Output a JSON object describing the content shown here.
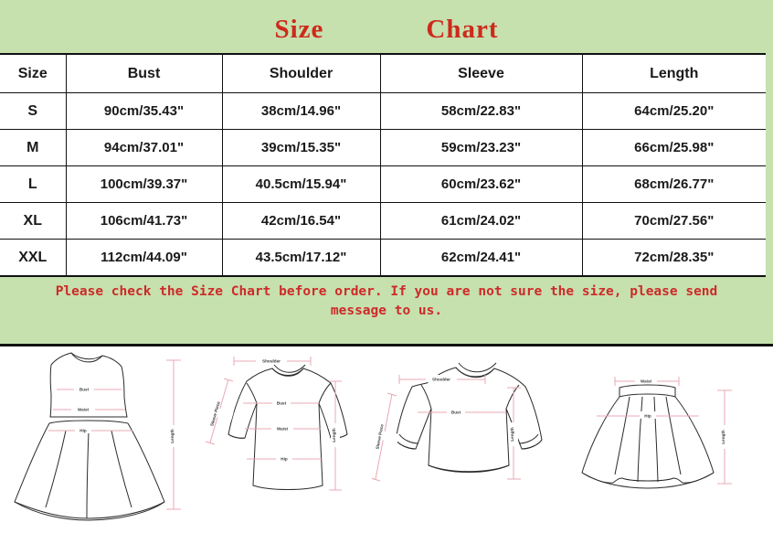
{
  "title": {
    "word1": "Size",
    "word2": "Chart"
  },
  "colors": {
    "panel_green": "#c6e0ae",
    "title_red": "#cd2a1c",
    "note_red": "#cd2a2a",
    "border_black": "#111111",
    "measure_pink": "#e8a8b4",
    "garment_outline": "#2b2b2b"
  },
  "table": {
    "headers": [
      "Size",
      "Bust",
      "Shoulder",
      "Sleeve",
      "Length"
    ],
    "rows": [
      {
        "size": "S",
        "bust": "90cm/35.43\"",
        "shoulder": "38cm/14.96\"",
        "sleeve": "58cm/22.83\"",
        "length": "64cm/25.20\""
      },
      {
        "size": "M",
        "bust": "94cm/37.01\"",
        "shoulder": "39cm/15.35\"",
        "sleeve": "59cm/23.23\"",
        "length": "66cm/25.98\""
      },
      {
        "size": "L",
        "bust": "100cm/39.37\"",
        "shoulder": "40.5cm/15.94\"",
        "sleeve": "60cm/23.62\"",
        "length": "68cm/26.77\""
      },
      {
        "size": "XL",
        "bust": "106cm/41.73\"",
        "shoulder": "42cm/16.54\"",
        "sleeve": "61cm/24.02\"",
        "length": "70cm/27.56\""
      },
      {
        "size": "XXL",
        "bust": "112cm/44.09\"",
        "shoulder": "43.5cm/17.12\"",
        "sleeve": "62cm/24.41\"",
        "length": "72cm/28.35\""
      }
    ]
  },
  "note": {
    "line1": "Please check the Size Chart before order. If you are not sure the size, please send",
    "line2": "message to us."
  },
  "illustrations": [
    {
      "name": "dress",
      "labels": {
        "bust": "Bust",
        "waist": "Waist",
        "hip": "Hip",
        "length": "Length"
      }
    },
    {
      "name": "long-sleeve-top",
      "labels": {
        "shoulder": "Shoulder",
        "sleeve": "Sleeve Piece",
        "bust": "Bust",
        "waist": "Waist",
        "hip": "Hip",
        "length": "Length"
      }
    },
    {
      "name": "sweater",
      "labels": {
        "shoulder": "Shoulder",
        "sleeve": "Sleeve Piece",
        "bust": "Bust",
        "length": "Length"
      }
    },
    {
      "name": "skirt",
      "labels": {
        "waist": "Waist",
        "hip": "Hip",
        "length": "Length"
      }
    }
  ]
}
